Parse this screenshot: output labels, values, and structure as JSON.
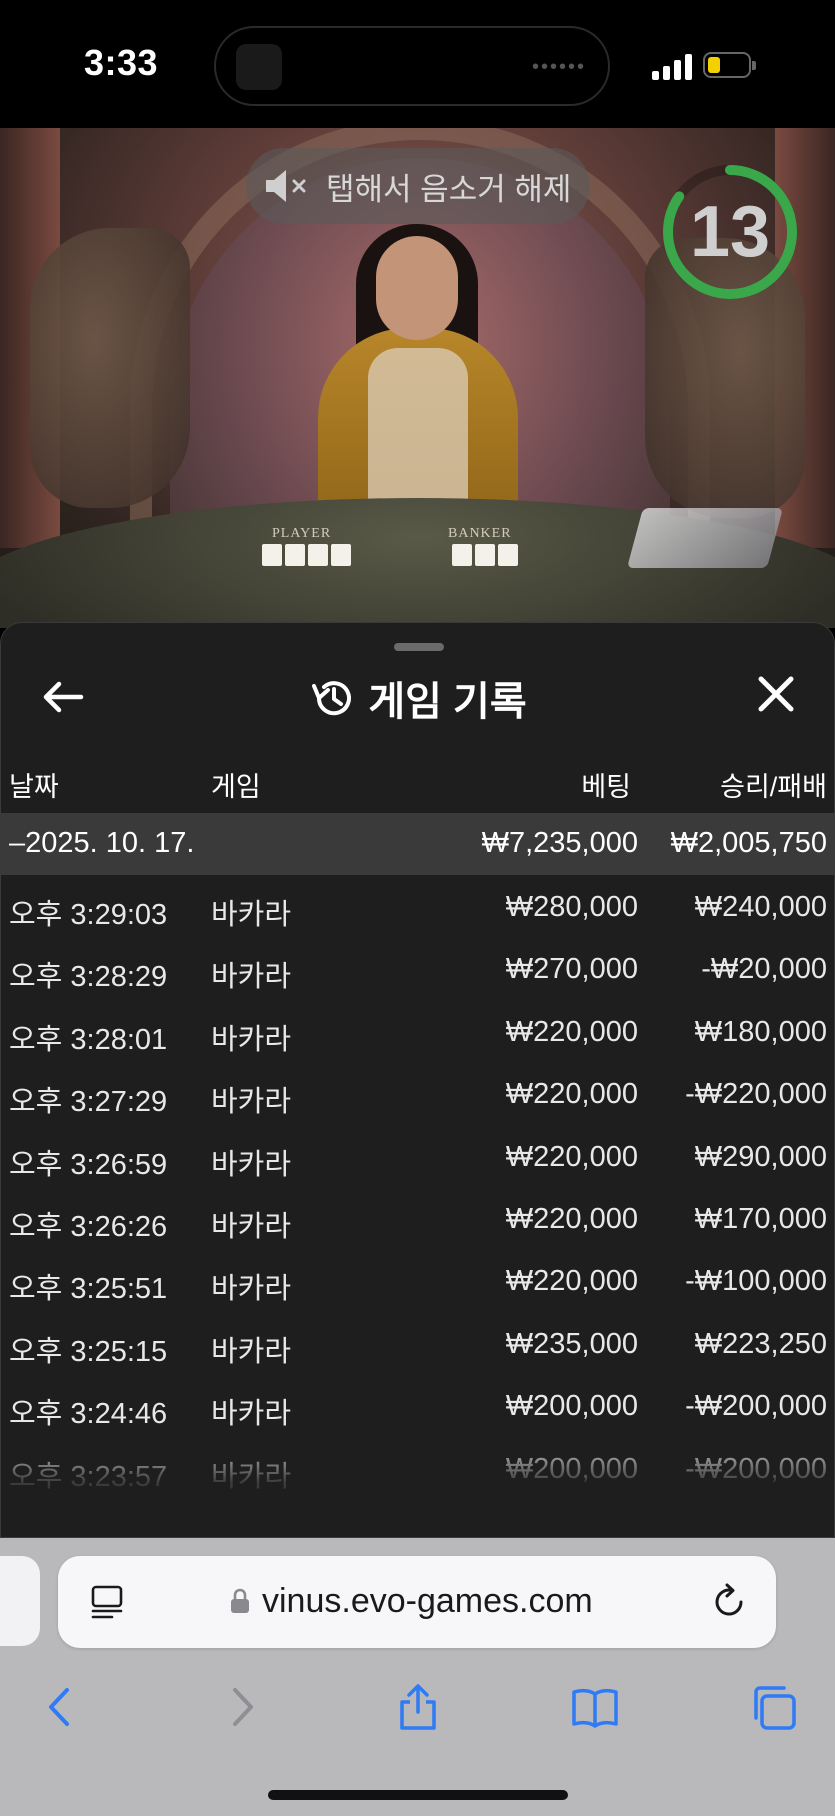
{
  "status_bar": {
    "time": "3:33",
    "battery_color": "#f5d000"
  },
  "video": {
    "mute_hint": "탭해서 음소거 해제",
    "countdown": "13",
    "countdown_color": "#3aa84a",
    "table_labels": {
      "player": "PLAYER",
      "banker": "BANKER"
    }
  },
  "sheet": {
    "title": "게임 기록",
    "back_icon": "arrow-left-icon",
    "close_icon": "close-icon",
    "title_icon": "history-icon",
    "columns": {
      "date": "날짜",
      "game": "게임",
      "bet": "베팅",
      "result": "승리/패배"
    },
    "group": {
      "date": "–2025. 10. 17.",
      "bet_total": "₩7,235,000",
      "result_total": "₩2,005,750"
    },
    "rows": [
      {
        "time": "오후 3:29:03",
        "game": "바카라",
        "bet": "₩280,000",
        "result": "₩240,000"
      },
      {
        "time": "오후 3:28:29",
        "game": "바카라",
        "bet": "₩270,000",
        "result": "-₩20,000"
      },
      {
        "time": "오후 3:28:01",
        "game": "바카라",
        "bet": "₩220,000",
        "result": "₩180,000"
      },
      {
        "time": "오후 3:27:29",
        "game": "바카라",
        "bet": "₩220,000",
        "result": "-₩220,000"
      },
      {
        "time": "오후 3:26:59",
        "game": "바카라",
        "bet": "₩220,000",
        "result": "₩290,000"
      },
      {
        "time": "오후 3:26:26",
        "game": "바카라",
        "bet": "₩220,000",
        "result": "₩170,000"
      },
      {
        "time": "오후 3:25:51",
        "game": "바카라",
        "bet": "₩220,000",
        "result": "-₩100,000"
      },
      {
        "time": "오후 3:25:15",
        "game": "바카라",
        "bet": "₩235,000",
        "result": "₩223,250"
      },
      {
        "time": "오후 3:24:46",
        "game": "바카라",
        "bet": "₩200,000",
        "result": "-₩200,000"
      },
      {
        "time": "오후 3:23:57",
        "game": "바카라",
        "bet": "₩200,000",
        "result": "-₩200,000"
      }
    ]
  },
  "browser": {
    "url": "vinus.evo-games.com",
    "accent_color": "#2f7bf5",
    "toolbar_icons": [
      "back-icon",
      "forward-icon",
      "share-icon",
      "bookmarks-icon",
      "tabs-icon"
    ]
  }
}
